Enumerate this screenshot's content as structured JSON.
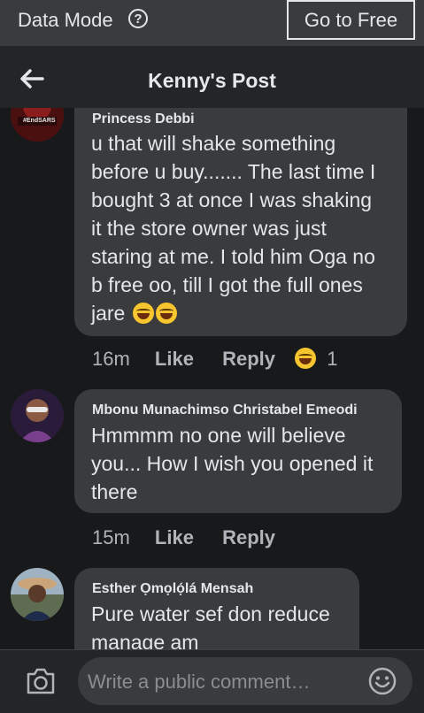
{
  "topbar": {
    "mode_label": "Data Mode",
    "help_icon": "?",
    "free_button": "Go to Free"
  },
  "header": {
    "title": "Kenny's Post"
  },
  "comments": [
    {
      "name": "Princess Debbi",
      "text": [
        "u that will shake something",
        "before u buy....... The last time I",
        "bought 3 at once I was shaking",
        "it the store owner was just",
        "staring at me. I told him Oga no",
        "b free oo, till I got the full ones",
        "jare"
      ],
      "avatar_caption": "#EndSARS",
      "time": "16m",
      "like": "Like",
      "reply": "Reply",
      "reactions": "1"
    },
    {
      "name": "Mbonu Munachimso Christabel Emeodi",
      "text": [
        "Hmmmm no one will believe",
        "you... How I wish you opened it",
        "there"
      ],
      "time": "15m",
      "like": "Like",
      "reply": "Reply"
    },
    {
      "name": "Esther Ọmọlọ́lá Mensah",
      "text": [
        "Pure water sef don reduce",
        "manage am"
      ]
    }
  ],
  "composer": {
    "placeholder": "Write a public comment…"
  }
}
